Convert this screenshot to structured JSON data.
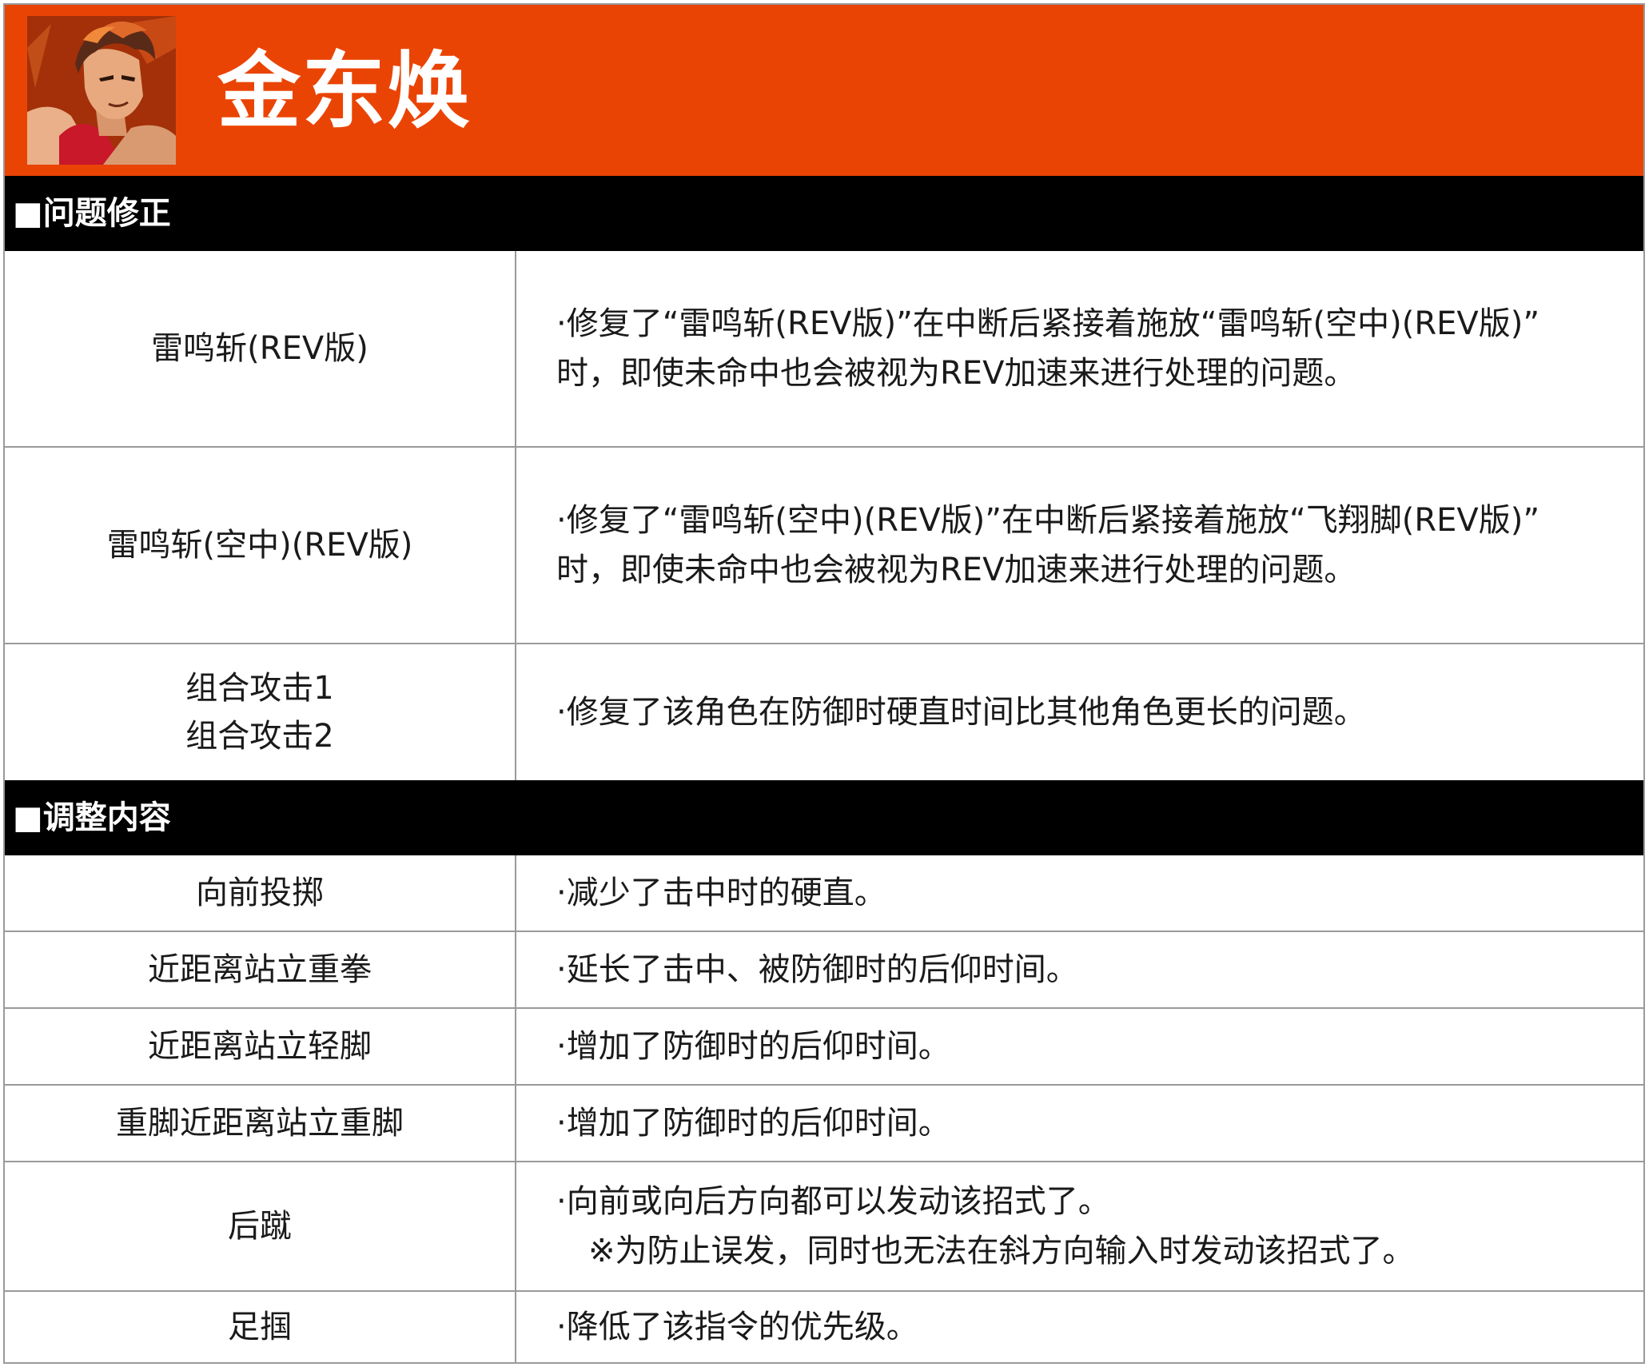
{
  "header": {
    "character_name": "金东焕",
    "accent_color": "#ea4404",
    "portrait_icon": "character-portrait"
  },
  "sections": {
    "fixes": {
      "title": "■问题修正",
      "rows": [
        {
          "move": [
            "雷鸣斩(REV版)"
          ],
          "desc": [
            "·修复了“雷鸣斩(REV版)”在中断后紧接着施放“雷鸣斩(空中)(REV版)”",
            "时，即使未命中也会被视为REV加速来进行处理的问题。"
          ]
        },
        {
          "move": [
            "雷鸣斩(空中)(REV版)"
          ],
          "desc": [
            "·修复了“雷鸣斩(空中)(REV版)”在中断后紧接着施放“飞翔脚(REV版)”",
            "时，即使未命中也会被视为REV加速来进行处理的问题。"
          ]
        },
        {
          "move": [
            "组合攻击1",
            "组合攻击2"
          ],
          "desc": [
            "·修复了该角色在防御时硬直时间比其他角色更长的问题。"
          ]
        }
      ]
    },
    "adjustments": {
      "title": "■调整内容",
      "rows": [
        {
          "move": [
            "向前投掷"
          ],
          "desc": [
            "·减少了击中时的硬直。"
          ]
        },
        {
          "move": [
            "近距离站立重拳"
          ],
          "desc": [
            "·延长了击中、被防御时的后仰时间。"
          ]
        },
        {
          "move": [
            "近距离站立轻脚"
          ],
          "desc": [
            "·增加了防御时的后仰时间。"
          ]
        },
        {
          "move": [
            "重脚近距离站立重脚"
          ],
          "desc": [
            "·增加了防御时的后仰时间。"
          ]
        },
        {
          "move": [
            "后蹴"
          ],
          "desc": [
            "·向前或向后方向都可以发动该招式了。"
          ],
          "note": "※为防止误发，同时也无法在斜方向输入时发动该招式了。"
        },
        {
          "move": [
            "足掴"
          ],
          "desc": [
            "·降低了该指令的优先级。"
          ]
        }
      ]
    }
  }
}
